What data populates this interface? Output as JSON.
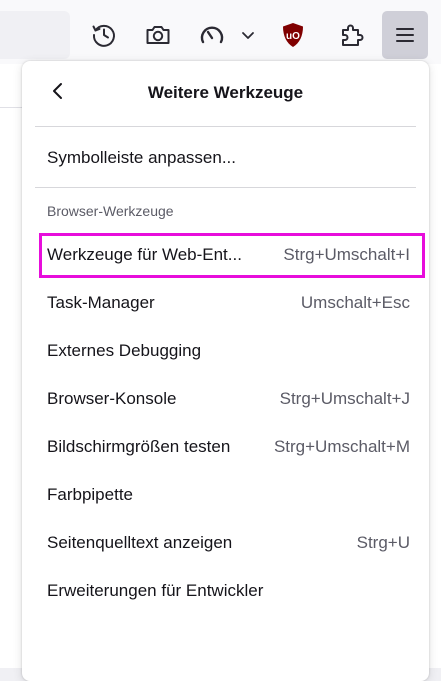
{
  "toolbar": {
    "buttons": [
      {
        "name": "history-icon"
      },
      {
        "name": "camera-icon"
      },
      {
        "name": "gauge-icon"
      },
      {
        "name": "chevron-down-icon"
      },
      {
        "name": "ublock-origin-icon",
        "color": "#800000"
      },
      {
        "name": "puzzle-extensions-icon"
      },
      {
        "name": "hamburger-menu-icon",
        "active": true
      }
    ]
  },
  "panel": {
    "title": "Weitere Werkzeuge",
    "back_icon": "chevron-left-icon",
    "customize_label": "Symbolleiste anpassen...",
    "section_label": "Browser-Werkzeuge",
    "items": [
      {
        "label": "Werkzeuge für Web-Ent...",
        "shortcut": "Strg+Umschalt+I",
        "highlighted": true
      },
      {
        "label": "Task-Manager",
        "shortcut": "Umschalt+Esc"
      },
      {
        "label": "Externes Debugging",
        "shortcut": ""
      },
      {
        "label": "Browser-Konsole",
        "shortcut": "Strg+Umschalt+J"
      },
      {
        "label": "Bildschirmgrößen testen",
        "shortcut": "Strg+Umschalt+M"
      },
      {
        "label": "Farbpipette",
        "shortcut": ""
      },
      {
        "label": "Seitenquelltext anzeigen",
        "shortcut": "Strg+U"
      },
      {
        "label": "Erweiterungen für Entwickler",
        "shortcut": ""
      }
    ],
    "highlight_color": "#e70ddb"
  }
}
